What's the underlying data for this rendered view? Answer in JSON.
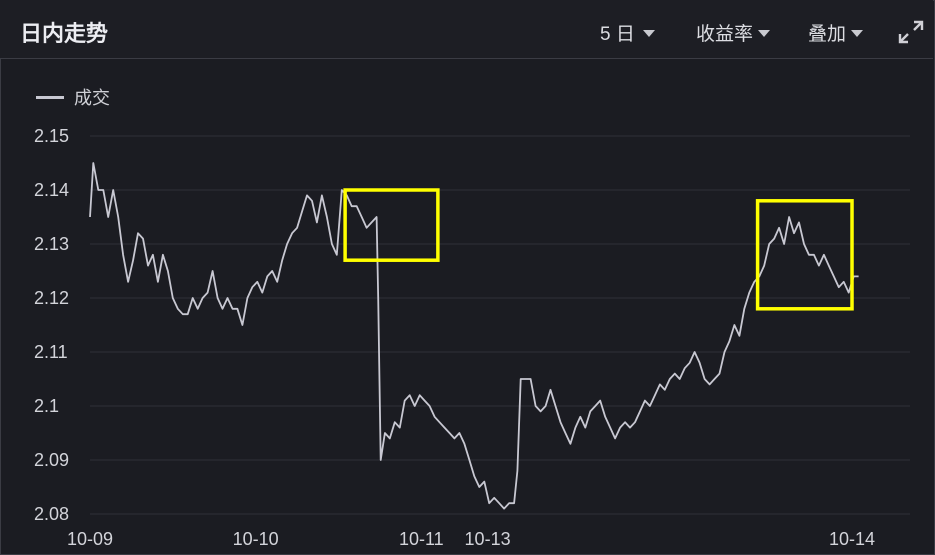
{
  "header": {
    "title": "日内走势",
    "period_label": "5 日",
    "metric_label": "收益率",
    "overlay_label": "叠加"
  },
  "icons": {
    "expand": "expand-arrows-icon"
  },
  "colors": {
    "background": "#1b1c22",
    "line": "#c8c8d2",
    "grid": "#2f3038",
    "highlight_box": "#ffff00"
  },
  "chart_data": {
    "type": "line",
    "title": "",
    "xlabel": "",
    "ylabel": "",
    "ylim": [
      2.08,
      2.15
    ],
    "yticks": [
      "2.15",
      "2.14",
      "2.13",
      "2.12",
      "2.11",
      "2.1",
      "2.09",
      "2.08"
    ],
    "xticks": [
      {
        "x": 0.0,
        "label": "10-09"
      },
      {
        "x": 1.0,
        "label": "10-10"
      },
      {
        "x": 2.0,
        "label": "10-11"
      },
      {
        "x": 2.4,
        "label": "10-13"
      },
      {
        "x": 4.6,
        "label": "10-14"
      }
    ],
    "x_range": [
      0.0,
      4.95
    ],
    "grid": true,
    "legend": {
      "position": "top-left",
      "entries": [
        "成交"
      ]
    },
    "series": [
      {
        "name": "成交",
        "points": [
          [
            0.0,
            2.135
          ],
          [
            0.02,
            2.145
          ],
          [
            0.05,
            2.14
          ],
          [
            0.08,
            2.14
          ],
          [
            0.11,
            2.135
          ],
          [
            0.14,
            2.14
          ],
          [
            0.17,
            2.135
          ],
          [
            0.2,
            2.128
          ],
          [
            0.23,
            2.123
          ],
          [
            0.26,
            2.127
          ],
          [
            0.29,
            2.132
          ],
          [
            0.32,
            2.131
          ],
          [
            0.35,
            2.126
          ],
          [
            0.38,
            2.128
          ],
          [
            0.41,
            2.123
          ],
          [
            0.44,
            2.128
          ],
          [
            0.47,
            2.125
          ],
          [
            0.5,
            2.12
          ],
          [
            0.53,
            2.118
          ],
          [
            0.56,
            2.117
          ],
          [
            0.59,
            2.117
          ],
          [
            0.62,
            2.12
          ],
          [
            0.65,
            2.118
          ],
          [
            0.68,
            2.12
          ],
          [
            0.71,
            2.121
          ],
          [
            0.74,
            2.125
          ],
          [
            0.77,
            2.12
          ],
          [
            0.8,
            2.118
          ],
          [
            0.83,
            2.12
          ],
          [
            0.86,
            2.118
          ],
          [
            0.89,
            2.118
          ],
          [
            0.92,
            2.115
          ],
          [
            0.95,
            2.12
          ],
          [
            0.98,
            2.122
          ],
          [
            1.01,
            2.123
          ],
          [
            1.04,
            2.121
          ],
          [
            1.07,
            2.124
          ],
          [
            1.1,
            2.125
          ],
          [
            1.13,
            2.123
          ],
          [
            1.16,
            2.127
          ],
          [
            1.19,
            2.13
          ],
          [
            1.22,
            2.132
          ],
          [
            1.25,
            2.133
          ],
          [
            1.28,
            2.136
          ],
          [
            1.31,
            2.139
          ],
          [
            1.34,
            2.138
          ],
          [
            1.37,
            2.134
          ],
          [
            1.4,
            2.139
          ],
          [
            1.43,
            2.135
          ],
          [
            1.46,
            2.13
          ],
          [
            1.49,
            2.128
          ],
          [
            1.52,
            2.14
          ],
          [
            1.55,
            2.139
          ],
          [
            1.58,
            2.137
          ],
          [
            1.61,
            2.137
          ],
          [
            1.64,
            2.135
          ],
          [
            1.67,
            2.133
          ],
          [
            1.7,
            2.134
          ],
          [
            1.73,
            2.135
          ],
          [
            1.74,
            2.12
          ],
          [
            1.755,
            2.09
          ],
          [
            1.78,
            2.095
          ],
          [
            1.81,
            2.094
          ],
          [
            1.84,
            2.097
          ],
          [
            1.87,
            2.096
          ],
          [
            1.9,
            2.101
          ],
          [
            1.93,
            2.102
          ],
          [
            1.96,
            2.1
          ],
          [
            1.99,
            2.102
          ],
          [
            2.02,
            2.101
          ],
          [
            2.05,
            2.1
          ],
          [
            2.08,
            2.098
          ],
          [
            2.11,
            2.097
          ],
          [
            2.14,
            2.096
          ],
          [
            2.17,
            2.095
          ],
          [
            2.2,
            2.094
          ],
          [
            2.23,
            2.095
          ],
          [
            2.26,
            2.093
          ],
          [
            2.29,
            2.09
          ],
          [
            2.32,
            2.087
          ],
          [
            2.35,
            2.085
          ],
          [
            2.38,
            2.086
          ],
          [
            2.41,
            2.082
          ],
          [
            2.44,
            2.083
          ],
          [
            2.47,
            2.082
          ],
          [
            2.5,
            2.081
          ],
          [
            2.53,
            2.082
          ],
          [
            2.56,
            2.082
          ],
          [
            2.58,
            2.088
          ],
          [
            2.6,
            2.105
          ],
          [
            2.63,
            2.105
          ],
          [
            2.66,
            2.105
          ],
          [
            2.69,
            2.1
          ],
          [
            2.72,
            2.099
          ],
          [
            2.75,
            2.1
          ],
          [
            2.78,
            2.103
          ],
          [
            2.81,
            2.1
          ],
          [
            2.84,
            2.097
          ],
          [
            2.87,
            2.095
          ],
          [
            2.9,
            2.093
          ],
          [
            2.93,
            2.096
          ],
          [
            2.96,
            2.098
          ],
          [
            2.99,
            2.096
          ],
          [
            3.02,
            2.099
          ],
          [
            3.05,
            2.1
          ],
          [
            3.08,
            2.101
          ],
          [
            3.11,
            2.098
          ],
          [
            3.14,
            2.096
          ],
          [
            3.17,
            2.094
          ],
          [
            3.2,
            2.096
          ],
          [
            3.23,
            2.097
          ],
          [
            3.26,
            2.096
          ],
          [
            3.29,
            2.097
          ],
          [
            3.32,
            2.099
          ],
          [
            3.35,
            2.101
          ],
          [
            3.38,
            2.1
          ],
          [
            3.41,
            2.102
          ],
          [
            3.44,
            2.104
          ],
          [
            3.47,
            2.103
          ],
          [
            3.5,
            2.105
          ],
          [
            3.53,
            2.106
          ],
          [
            3.56,
            2.105
          ],
          [
            3.59,
            2.107
          ],
          [
            3.62,
            2.108
          ],
          [
            3.65,
            2.11
          ],
          [
            3.68,
            2.108
          ],
          [
            3.71,
            2.105
          ],
          [
            3.74,
            2.104
          ],
          [
            3.77,
            2.105
          ],
          [
            3.8,
            2.106
          ],
          [
            3.83,
            2.11
          ],
          [
            3.86,
            2.112
          ],
          [
            3.89,
            2.115
          ],
          [
            3.92,
            2.113
          ],
          [
            3.95,
            2.118
          ],
          [
            3.98,
            2.121
          ],
          [
            4.01,
            2.123
          ],
          [
            4.04,
            2.124
          ],
          [
            4.07,
            2.126
          ],
          [
            4.1,
            2.13
          ],
          [
            4.13,
            2.131
          ],
          [
            4.16,
            2.133
          ],
          [
            4.19,
            2.13
          ],
          [
            4.22,
            2.135
          ],
          [
            4.25,
            2.132
          ],
          [
            4.28,
            2.134
          ],
          [
            4.31,
            2.13
          ],
          [
            4.34,
            2.128
          ],
          [
            4.37,
            2.128
          ],
          [
            4.4,
            2.126
          ],
          [
            4.43,
            2.128
          ],
          [
            4.46,
            2.126
          ],
          [
            4.49,
            2.124
          ],
          [
            4.52,
            2.122
          ],
          [
            4.55,
            2.123
          ],
          [
            4.58,
            2.121
          ],
          [
            4.61,
            2.124
          ],
          [
            4.64,
            2.124
          ]
        ]
      }
    ],
    "annotations": [
      {
        "type": "highlight_box",
        "x_range": [
          1.54,
          2.1
        ],
        "y_range": [
          2.127,
          2.14
        ]
      },
      {
        "type": "highlight_box",
        "x_range": [
          4.03,
          4.6
        ],
        "y_range": [
          2.118,
          2.138
        ]
      }
    ]
  }
}
